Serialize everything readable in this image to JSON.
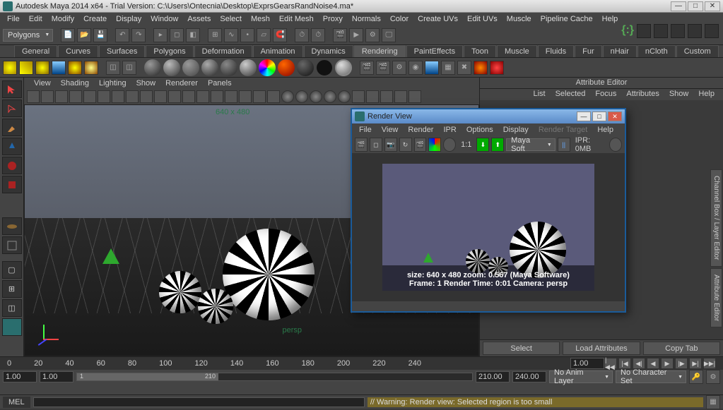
{
  "window": {
    "title": "Autodesk Maya 2014 x64 - Trial Version: C:\\Users\\Ontecnia\\Desktop\\ExprsGearsRandNoise4.ma*"
  },
  "main_menu": [
    "File",
    "Edit",
    "Modify",
    "Create",
    "Display",
    "Window",
    "Assets",
    "Select",
    "Mesh",
    "Edit Mesh",
    "Proxy",
    "Normals",
    "Color",
    "Create UVs",
    "Edit UVs",
    "Muscle",
    "Pipeline Cache",
    "Help"
  ],
  "module_dropdown": "Polygons",
  "shelf_tabs": [
    "General",
    "Curves",
    "Surfaces",
    "Polygons",
    "Deformation",
    "Animation",
    "Dynamics",
    "Rendering",
    "PaintEffects",
    "Toon",
    "Muscle",
    "Fluids",
    "Fur",
    "nHair",
    "nCloth",
    "Custom"
  ],
  "active_shelf": "Rendering",
  "viewport_menu": [
    "View",
    "Shading",
    "Lighting",
    "Show",
    "Renderer",
    "Panels"
  ],
  "gate_resolution": "640 x 480",
  "persp_label": "persp",
  "attr_editor": {
    "title": "Attribute Editor",
    "menu": [
      "List",
      "Selected",
      "Focus",
      "Attributes",
      "Show",
      "Help"
    ],
    "buttons": {
      "select": "Select",
      "load": "Load Attributes",
      "copy": "Copy Tab"
    }
  },
  "side_tabs": [
    "Channel Box / Layer Editor",
    "Attribute Editor"
  ],
  "timeline": {
    "ticks": [
      "0",
      "20",
      "40",
      "60",
      "80",
      "100",
      "120",
      "140",
      "160",
      "180",
      "200",
      "220",
      "240"
    ],
    "range": {
      "start": "1",
      "end": "210"
    },
    "start_frame": "1.00",
    "end_frame": "1.00",
    "range_start": "210.00",
    "range_end": "240.00",
    "current": "1.00",
    "anim_layer": "No Anim Layer",
    "char_set": "No Character Set"
  },
  "command": {
    "lang": "MEL"
  },
  "status": {
    "warning": "// Warning: Render view: Selected region is too small"
  },
  "render_view": {
    "title": "Render View",
    "menu": [
      "File",
      "View",
      "Render",
      "IPR",
      "Options",
      "Display",
      "Render Target",
      "Help"
    ],
    "renderer": "Maya Soft",
    "ipr_label": "IPR: 0MB",
    "ratio": "1:1",
    "info_line1": "size: 640 x 480     zoom: 0.567     (Maya Software)",
    "info_line2": "Frame: 1        Render Time: 0:01        Camera: persp"
  }
}
